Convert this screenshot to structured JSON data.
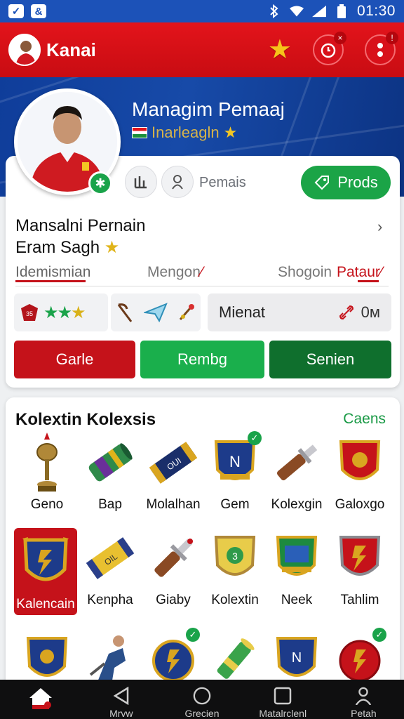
{
  "status_bar": {
    "time": "01:30",
    "icons": [
      "notification-icon-1",
      "notification-icon-2",
      "bluetooth-icon",
      "wifi-icon",
      "signal-icon",
      "battery-icon"
    ]
  },
  "app_bar": {
    "title": "Kanai",
    "actions": [
      "favorite-star-icon",
      "alarm-icon",
      "more-icon"
    ]
  },
  "hero": {
    "title": "Managim Pemaaj",
    "subtitle": "Inarleagln"
  },
  "profile": {
    "pemais_label": "Pemais",
    "prods_label": "Prods",
    "name_line1": "Mansalni Pernain",
    "name_line2": "Eram Sagh",
    "tabs": [
      {
        "label": "Idemismian",
        "active": true
      },
      {
        "label": "Mengon",
        "active": false
      },
      {
        "label": "Shogoin",
        "active": false
      },
      {
        "label": "Pataur",
        "active": true
      }
    ],
    "mienat": {
      "label": "Mienat",
      "value": "0м"
    },
    "buttons": [
      {
        "label": "Garle",
        "color": "#c5121a"
      },
      {
        "label": "Rembg",
        "color": "#1aaf4c"
      },
      {
        "label": "Senien",
        "color": "#0f6f2d"
      }
    ]
  },
  "collection": {
    "title": "Kolextin Kolexsis",
    "link": "Caens",
    "items": [
      {
        "label": "Geno",
        "icon": "trophy-icon"
      },
      {
        "label": "Bap",
        "icon": "scroll-icon"
      },
      {
        "label": "Molalhan",
        "icon": "scroll-icon"
      },
      {
        "label": "Gem",
        "icon": "shield-icon"
      },
      {
        "label": "Kolexgin",
        "icon": "sword-icon"
      },
      {
        "label": "Galoxgo",
        "icon": "shield-icon"
      },
      {
        "label": "Kalencain",
        "icon": "shield-icon"
      },
      {
        "label": "Kenpha",
        "icon": "scroll-icon"
      },
      {
        "label": "Giaby",
        "icon": "sword-icon"
      },
      {
        "label": "Kolextin",
        "icon": "shield-icon"
      },
      {
        "label": "Neek",
        "icon": "shield-icon"
      },
      {
        "label": "Tahlim",
        "icon": "shield-icon"
      },
      {
        "label": "",
        "icon": "shield-icon"
      },
      {
        "label": "",
        "icon": "player-figure-icon"
      },
      {
        "label": "",
        "icon": "emblem-icon"
      },
      {
        "label": "",
        "icon": "scroll-icon"
      },
      {
        "label": "",
        "icon": "shield-icon"
      },
      {
        "label": "",
        "icon": "emblem-icon"
      }
    ]
  },
  "bottom_nav": [
    {
      "label": "",
      "icon": "home-icon",
      "active": true
    },
    {
      "label": "Mrvw",
      "icon": "back-triangle-icon"
    },
    {
      "label": "Grecien",
      "icon": "circle-home-icon"
    },
    {
      "label": "Matalrclenl",
      "icon": "square-recent-icon"
    },
    {
      "label": "Petah",
      "icon": "profile-icon"
    }
  ]
}
